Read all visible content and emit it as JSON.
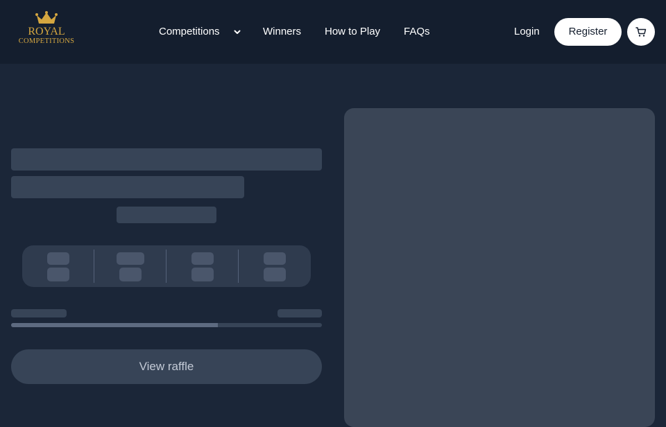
{
  "brand": {
    "line1": "ROYAL",
    "line2": "COMPETITIONS",
    "color": "#d4a640",
    "icon": "crown-icon"
  },
  "nav": {
    "items": [
      {
        "label": "Competitions",
        "has_dropdown": true
      },
      {
        "label": "Winners"
      },
      {
        "label": "How to Play"
      },
      {
        "label": "FAQs"
      }
    ]
  },
  "header_actions": {
    "login_label": "Login",
    "register_label": "Register",
    "cart_icon": "cart-icon"
  },
  "raffle_card": {
    "progress_fraction": 0.665,
    "view_button_label": "View raffle"
  },
  "colors": {
    "page_bg": "#1b2638",
    "header_bg": "#141e2e",
    "skeleton": "#374457"
  }
}
